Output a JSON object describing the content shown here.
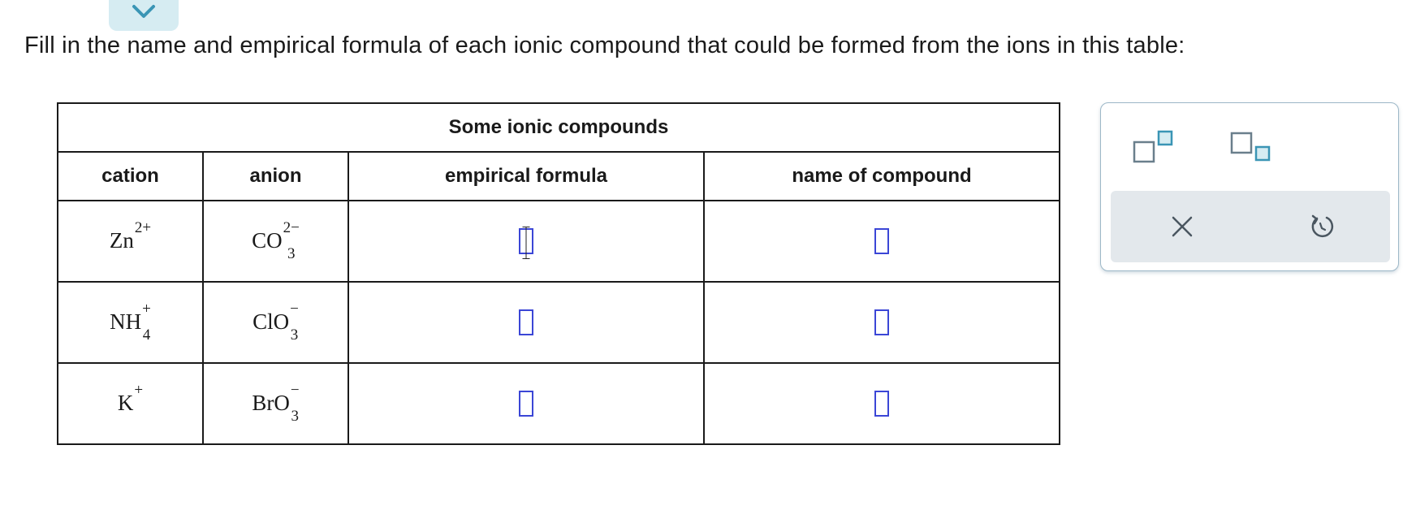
{
  "prompt": "Fill in the name and empirical formula of each ionic compound that could be formed from the ions in this table:",
  "table": {
    "caption": "Some ionic compounds",
    "headers": {
      "cation": "cation",
      "anion": "anion",
      "formula": "empirical formula",
      "name": "name of compound"
    },
    "rows": [
      {
        "cation": {
          "base": "Zn",
          "sub": "",
          "charge": "2+"
        },
        "anion": {
          "base": "CO",
          "sub": "3",
          "charge": "2−"
        },
        "formula_value": "",
        "name_value": ""
      },
      {
        "cation": {
          "base": "NH",
          "sub": "4",
          "charge": "+"
        },
        "anion": {
          "base": "ClO",
          "sub": "3",
          "charge": "−"
        },
        "formula_value": "",
        "name_value": ""
      },
      {
        "cation": {
          "base": "K",
          "sub": "",
          "charge": "+"
        },
        "anion": {
          "base": "BrO",
          "sub": "3",
          "charge": "−"
        },
        "formula_value": "",
        "name_value": ""
      }
    ]
  },
  "toolbox": {
    "tools": [
      "superscript-icon",
      "subscript-icon"
    ],
    "actions": [
      "clear-icon",
      "undo-icon"
    ]
  },
  "colors": {
    "input_box": "#3b46d6",
    "tab_bg": "#d6ecf2",
    "tab_chevron": "#3a95b5",
    "toolbox_border": "#9db8c8",
    "action_bar": "#e3e8ec"
  }
}
